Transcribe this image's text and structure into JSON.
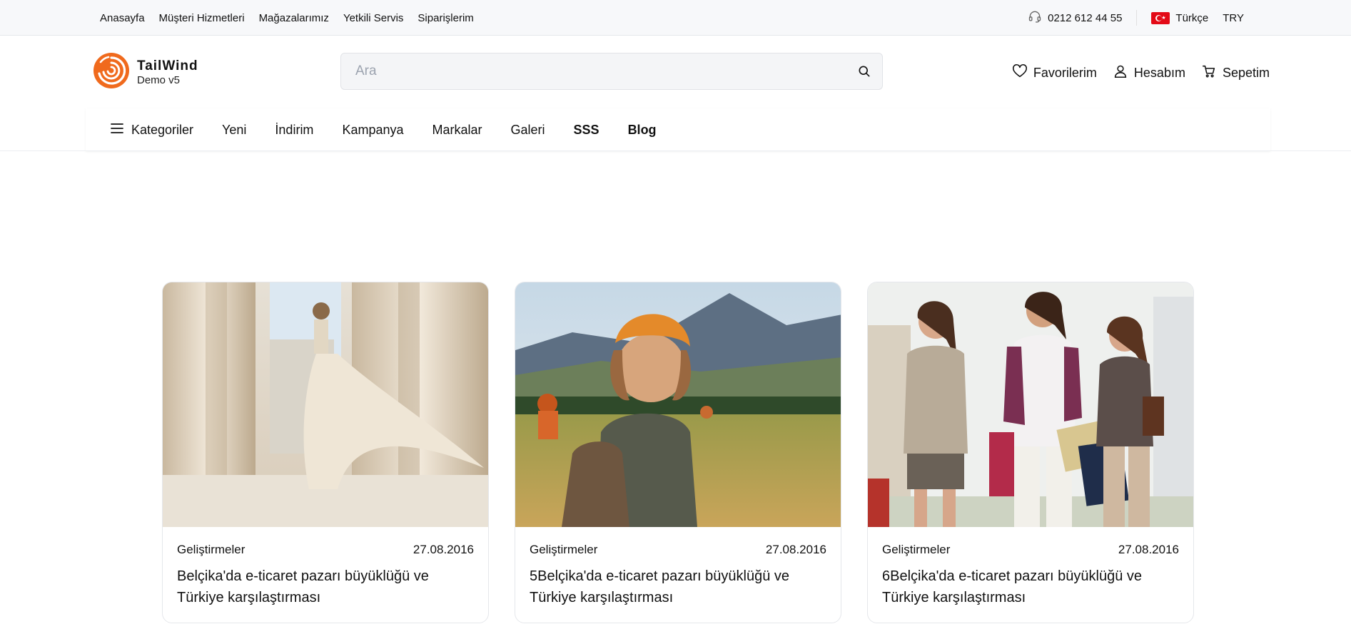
{
  "topbar": {
    "links": [
      "Anasayfa",
      "Müşteri Hizmetleri",
      "Mağazalarımız",
      "Yetkili Servis",
      "Siparişlerim"
    ],
    "phone": "0212 612 44 55",
    "language": "Türkçe",
    "currency": "TRY"
  },
  "header": {
    "brand_name": "TailWind",
    "brand_sub": "Demo v5",
    "search_placeholder": "Ara",
    "favorites": "Favorilerim",
    "account": "Hesabım",
    "cart": "Sepetim"
  },
  "nav": {
    "categories": "Kategoriler",
    "items": [
      "Yeni",
      "İndirim",
      "Kampanya",
      "Markalar",
      "Galeri",
      "SSS",
      "Blog"
    ]
  },
  "colors": {
    "brand_orange": "#f06a1d",
    "flag_red": "#e30a17"
  },
  "cards": [
    {
      "category": "Geliştirmeler",
      "date": "27.08.2016",
      "title": "Belçika'da e-ticaret pazarı büyüklüğü ve Türkiye karşılaştırması"
    },
    {
      "category": "Geliştirmeler",
      "date": "27.08.2016",
      "title": "5Belçika'da e-ticaret pazarı büyüklüğü ve Türkiye karşılaştırması"
    },
    {
      "category": "Geliştirmeler",
      "date": "27.08.2016",
      "title": "6Belçika'da e-ticaret pazarı büyüklüğü ve Türkiye karşılaştırması"
    }
  ]
}
